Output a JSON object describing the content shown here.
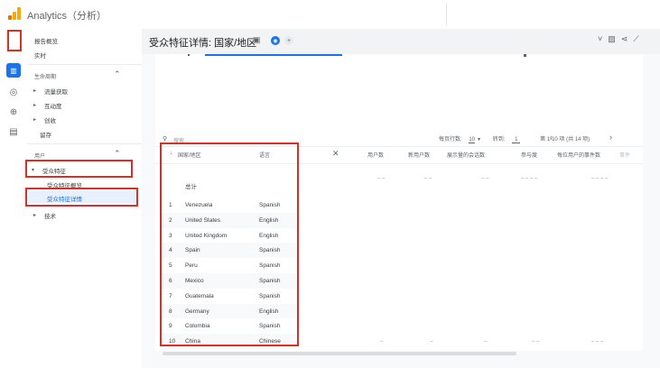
{
  "app": {
    "title": "Analytics（分析）"
  },
  "sidebar": {
    "top_items": [
      "报告概览",
      "实时"
    ],
    "lifecycle": {
      "heading": "生命周期",
      "items": [
        "流量获取",
        "互动度",
        "创收",
        "留存"
      ]
    },
    "user": {
      "heading": "用户",
      "group": "受众特征",
      "children": [
        "受众特征概览",
        "受众特征详情"
      ],
      "tech": "技术"
    }
  },
  "header": {
    "title": "受众特征详情: 国家/地区"
  },
  "table": {
    "search_placeholder": "搜索…",
    "rows_per_page_label": "每页行数:",
    "rows_per_page_value": "10",
    "goto_label": "转到:",
    "goto_value": "1",
    "page_info": "第 1-10 项 (共 14 项)",
    "headers": {
      "country": "国家/地区",
      "language": "语言",
      "c1": "用户数",
      "c2": "新用户数",
      "c3": "展示量的会话数",
      "c4": "参与度",
      "c5": "每位用户的事件数",
      "c6": "事件"
    },
    "total_label": "总计",
    "rows": [
      {
        "n": "1",
        "country": "Venezuela",
        "lang": "Spanish"
      },
      {
        "n": "2",
        "country": "United States",
        "lang": "English"
      },
      {
        "n": "3",
        "country": "United Kingdom",
        "lang": "English"
      },
      {
        "n": "4",
        "country": "Spain",
        "lang": "Spanish"
      },
      {
        "n": "5",
        "country": "Peru",
        "lang": "Spanish"
      },
      {
        "n": "6",
        "country": "Mexico",
        "lang": "Spanish"
      },
      {
        "n": "7",
        "country": "Guatemala",
        "lang": "Spanish"
      },
      {
        "n": "8",
        "country": "Germany",
        "lang": "English"
      },
      {
        "n": "9",
        "country": "Colombia",
        "lang": "Spanish"
      },
      {
        "n": "10",
        "country": "China",
        "lang": "Chinese"
      }
    ]
  },
  "colors": {
    "accent": "#1a73e8",
    "highlight_box": "#d93025",
    "selected_bg": "#e8f0fe",
    "logo_orange": "#f9ab00",
    "logo_dark": "#e37400"
  },
  "icons": [
    "bar-chart-icon",
    "explore-icon",
    "search-analytics-icon",
    "list-icon",
    "search-icon",
    "close-icon",
    "share-icon",
    "compare-icon",
    "doc-icon"
  ]
}
